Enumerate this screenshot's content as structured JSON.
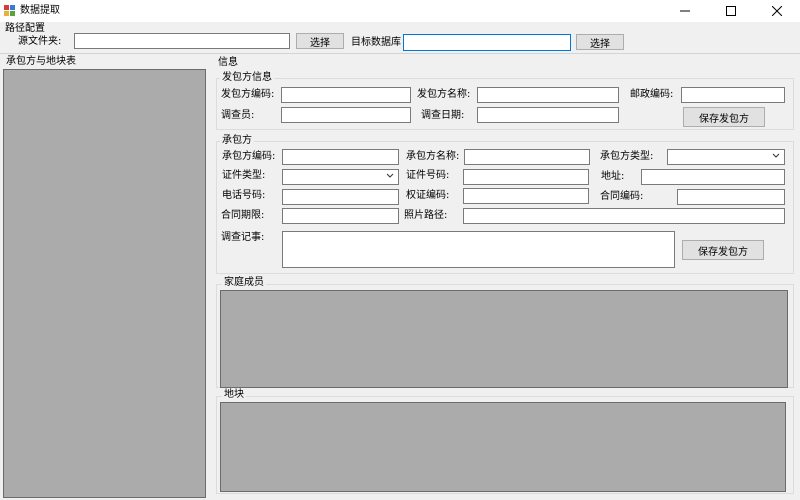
{
  "window": {
    "title": "数据提取",
    "minimize_icon": "minimize-icon",
    "maximize_icon": "maximize-icon",
    "close_icon": "close-icon"
  },
  "path_config": {
    "title": "路径配置",
    "source_folder_label": "源文件夹:",
    "source_folder_value": "",
    "select_button": "选择",
    "target_db_label": "目标数据库",
    "target_db_value": "",
    "select_button2": "选择"
  },
  "left_panel": {
    "title": "承包方与地块表"
  },
  "info": {
    "title": "信息",
    "issuer_group": {
      "title": "发包方信息",
      "code_label": "发包方编码:",
      "code_value": "",
      "name_label": "发包方名称:",
      "name_value": "",
      "postcode_label": "邮政编码:",
      "postcode_value": "",
      "surveyor_label": "调查员:",
      "surveyor_value": "",
      "survey_date_label": "调查日期:",
      "survey_date_value": "",
      "save_button": "保存发包方"
    },
    "contractor_group": {
      "title": "承包方",
      "code_label": "承包方编码:",
      "name_label": "承包方名称:",
      "type_label": "承包方类型:",
      "id_type_label": "证件类型:",
      "id_number_label": "证件号码:",
      "address_label": "地址:",
      "phone_label": "电话号码:",
      "right_code_label": "权证编码:",
      "contract_code_label": "合同编码:",
      "contract_term_label": "合同期限:",
      "photo_path_label": "照片路径:",
      "survey_notes_label": "调查记事:",
      "save_button": "保存发包方"
    },
    "family_group": {
      "title": "家庭成员"
    },
    "plot_group": {
      "title": "地块"
    }
  },
  "colors": {
    "grid_fill": "#ababab",
    "accent_border": "#0078d7",
    "background": "#f0f0f0"
  }
}
